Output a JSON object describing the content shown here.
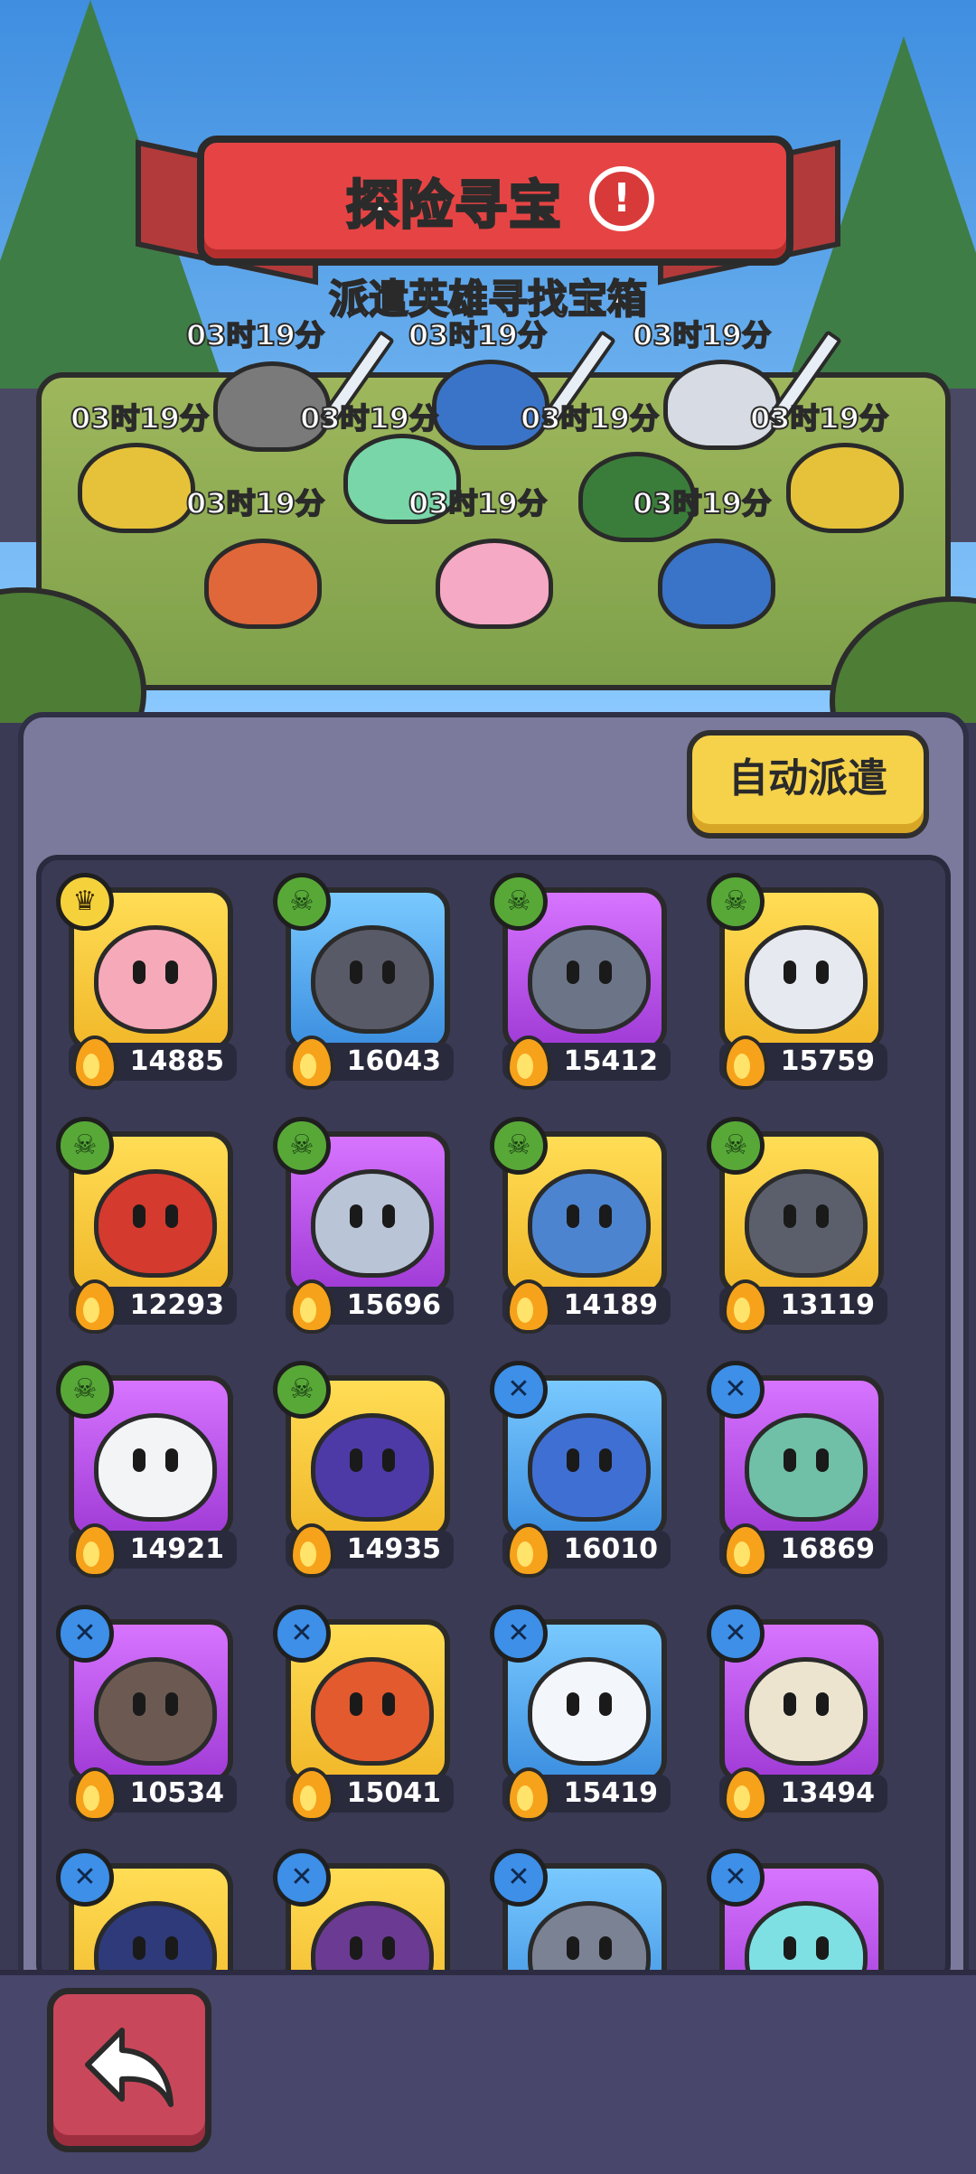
{
  "header": {
    "title": "探险寻宝",
    "alert_symbol": "!",
    "subtitle": "派遣英雄寻找宝箱"
  },
  "expedition": {
    "timers": [
      "03时19分",
      "03时19分",
      "03时19分",
      "03时19分",
      "03时19分",
      "03时19分",
      "03时19分",
      "03时19分",
      "03时19分",
      "03时19分"
    ]
  },
  "actions": {
    "auto_dispatch_label": "自动派遣",
    "back_icon": "back-arrow-icon"
  },
  "heroes": [
    {
      "power": "14885",
      "badge": "gold",
      "bg": "yellow",
      "face": "#f6a9b8"
    },
    {
      "power": "16043",
      "badge": "green",
      "bg": "blue",
      "face": "#585a67"
    },
    {
      "power": "15412",
      "badge": "green",
      "bg": "purple",
      "face": "#6b7587"
    },
    {
      "power": "15759",
      "badge": "green",
      "bg": "yellow",
      "face": "#e6e9ef"
    },
    {
      "power": "12293",
      "badge": "green",
      "bg": "yellow",
      "face": "#d43a2e"
    },
    {
      "power": "15696",
      "badge": "green",
      "bg": "purple",
      "face": "#b9c4d6"
    },
    {
      "power": "14189",
      "badge": "green",
      "bg": "yellow",
      "face": "#4d84cf"
    },
    {
      "power": "13119",
      "badge": "green",
      "bg": "yellow",
      "face": "#5b5f6b"
    },
    {
      "power": "14921",
      "badge": "green",
      "bg": "purple",
      "face": "#f2f4f6"
    },
    {
      "power": "14935",
      "badge": "green",
      "bg": "yellow",
      "face": "#4d3aa6"
    },
    {
      "power": "16010",
      "badge": "blue",
      "bg": "blue",
      "face": "#3f6fd2"
    },
    {
      "power": "16869",
      "badge": "blue",
      "bg": "purple",
      "face": "#6fc0a6"
    },
    {
      "power": "10534",
      "badge": "blue",
      "bg": "purple",
      "face": "#6c5a52"
    },
    {
      "power": "15041",
      "badge": "blue",
      "bg": "yellow",
      "face": "#e35a2e"
    },
    {
      "power": "15419",
      "badge": "blue",
      "bg": "blue",
      "face": "#f3f6fb"
    },
    {
      "power": "13494",
      "badge": "blue",
      "bg": "purple",
      "face": "#ece4cf"
    },
    {
      "power": "",
      "badge": "blue",
      "bg": "yellow",
      "face": "#2f3a7a"
    },
    {
      "power": "",
      "badge": "blue",
      "bg": "yellow",
      "face": "#6b3a92"
    },
    {
      "power": "",
      "badge": "blue",
      "bg": "blue",
      "face": "#7b8294"
    },
    {
      "power": "",
      "badge": "blue",
      "bg": "purple",
      "face": "#7fe0e4"
    }
  ]
}
